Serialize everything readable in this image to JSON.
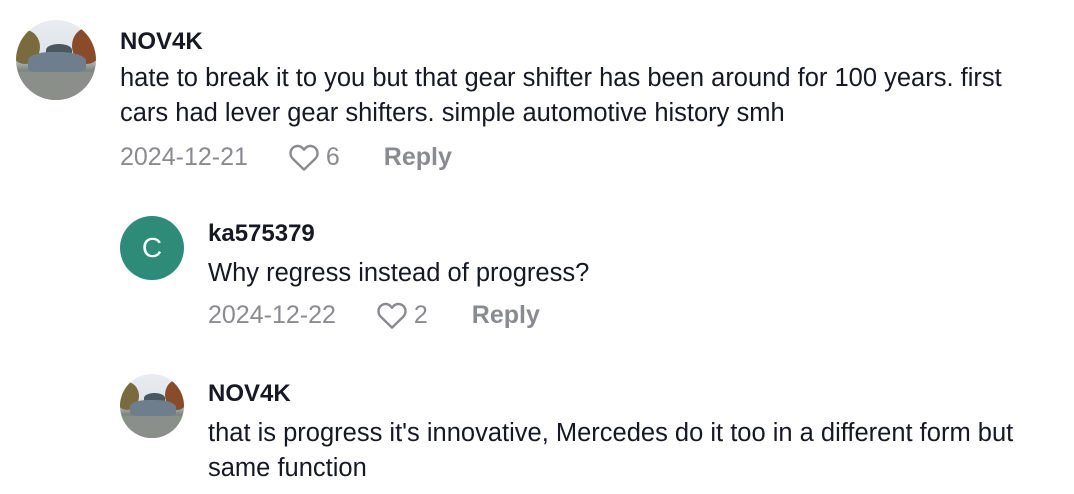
{
  "comments": [
    {
      "username": "NOV4K",
      "text": "hate to break it to you but that gear shifter has been around for 100 years. first cars had lever gear shifters. simple automotive history smh",
      "date": "2024-12-21",
      "likes": "6",
      "reply_label": "Reply",
      "avatar_type": "photo"
    },
    {
      "username": "ka575379",
      "avatar_letter": "C",
      "avatar_color": "#2e8b78",
      "text": "Why regress instead of progress?",
      "date": "2024-12-22",
      "likes": "2",
      "reply_label": "Reply"
    },
    {
      "username": "NOV4K",
      "text": "that is progress it's innovative, Mercedes do it too in a different form but same function",
      "avatar_type": "photo"
    }
  ],
  "icons": {
    "like": "heart-outline-icon"
  }
}
